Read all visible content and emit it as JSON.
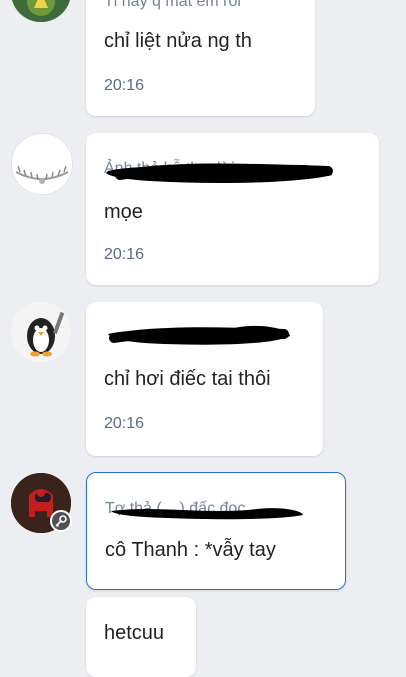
{
  "colors": {
    "background": "#eceef1",
    "bubble": "#ffffff",
    "selected_border": "#2a6fd6",
    "sender_text": "#74849b",
    "time_text": "#5b6b80"
  },
  "messages": [
    {
      "sender": "Tỉ hãy q mất em rồi",
      "text": "chỉ liệt nửa ng th",
      "time": "20:16"
    },
    {
      "sender": "Ảnh thả hỗ th... lời",
      "text": "mọe",
      "time": "20:16"
    },
    {
      "sender": "",
      "text": "chỉ hơi điếc tai thôi",
      "time": "20:16"
    },
    {
      "sender": "Tợ thả (... ) đấc đọc",
      "text": "cô Thanh : *vẫy tay",
      "time": ""
    },
    {
      "sender": "",
      "text": "hetcuu",
      "time": ""
    }
  ]
}
